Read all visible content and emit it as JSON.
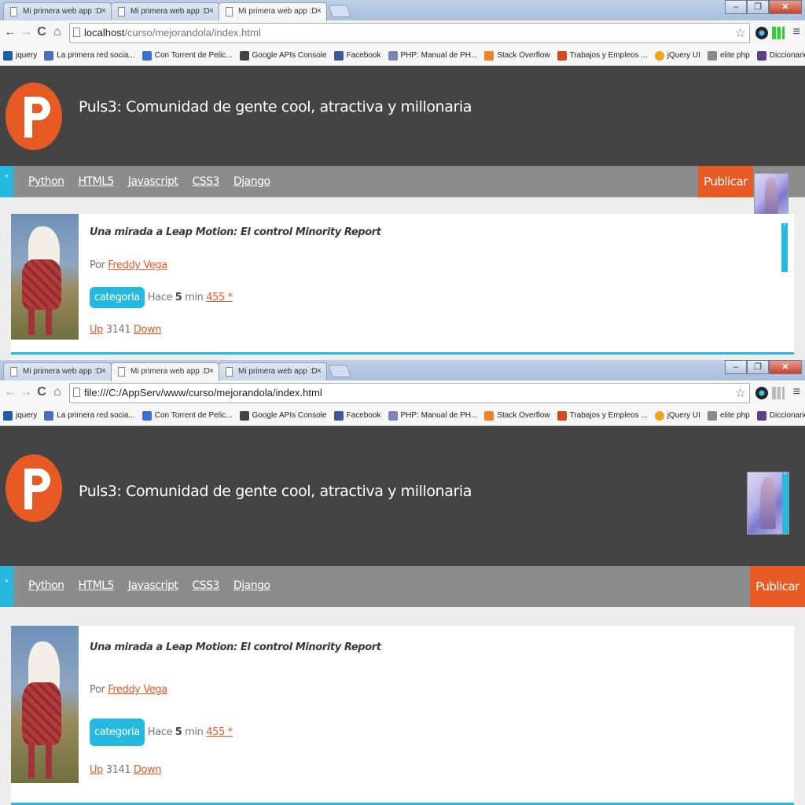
{
  "top": {
    "tabs": [
      {
        "label": "Mi primera web app :D",
        "close": "×"
      },
      {
        "label": "Mi primera web app :D",
        "close": "×"
      },
      {
        "label": "Mi primera web app :D",
        "close": "×"
      }
    ],
    "url_host": "localhost",
    "url_path": "/curso/mejorandola/index.html"
  },
  "bottom": {
    "tabs": [
      {
        "label": "Mi primera web app :D",
        "close": "×"
      },
      {
        "label": "Mi primera web app :D",
        "close": "×"
      },
      {
        "label": "Mi primera web app :D",
        "close": "×"
      }
    ],
    "url": "file:///C:/AppServ/www/curso/mejorandola/index.html"
  },
  "window_buttons": {
    "minimize": "–",
    "maximize": "❐",
    "close": "✕"
  },
  "nav_buttons": {
    "back": "←",
    "forward": "→",
    "reload": "C",
    "home": "⌂",
    "star": "☆",
    "menu": "≡"
  },
  "bookmarks": [
    {
      "label": "jquery",
      "icon": "jquery-icon",
      "color": "#1b5fa8"
    },
    {
      "label": "La primera red socia...",
      "icon": "social-network-icon",
      "color": "#4a6fbf"
    },
    {
      "label": "Con Torrent de Pelic...",
      "icon": "torrent-icon",
      "color": "#3b6fd4"
    },
    {
      "label": "Google APIs Console",
      "icon": "google-apis-icon",
      "color": "#444444"
    },
    {
      "label": "Facebook",
      "icon": "facebook-icon",
      "color": "#3b5998"
    },
    {
      "label": "PHP: Manual de PH...",
      "icon": "php-icon",
      "color": "#7a86b8"
    },
    {
      "label": "Stack Overflow",
      "icon": "stack-overflow-icon",
      "color": "#f48024"
    },
    {
      "label": "Trabajos y Empleos ...",
      "icon": "jobs-icon",
      "color": "#d44a1a"
    },
    {
      "label": "jQuery UI",
      "icon": "jquery-ui-icon",
      "color": "#f7a21b"
    },
    {
      "label": "elite php",
      "icon": "elite-php-icon",
      "color": "#8a8a8a"
    },
    {
      "label": "Diccionario Web",
      "icon": "dictionary-icon",
      "color": "#5a3f8a"
    }
  ],
  "site": {
    "title": "Puls3: Comunidad de gente cool, atractiva y millonaria",
    "logo_letter": "p",
    "nav_marker": "*",
    "nav": [
      "Python",
      "HTML5",
      "Javascript",
      "CSS3",
      "Django"
    ],
    "publish": "Publicar",
    "avatar_marker": "*"
  },
  "post": {
    "title": "Una mirada a Leap Motion: El control Minority Report",
    "by": "Por",
    "author": "Freddy Vega",
    "category": "categoria",
    "time_prefix": "Hace",
    "time_value": "5",
    "time_unit": "min",
    "comments": "455",
    "comments_suffix": "*",
    "up": "Up",
    "votes": "3141",
    "down": "Down"
  },
  "colors": {
    "accent_blue": "#26b9e0",
    "accent_orange": "#e85a24",
    "header_bg": "#444444",
    "nav_bg": "#8c8c8c"
  }
}
